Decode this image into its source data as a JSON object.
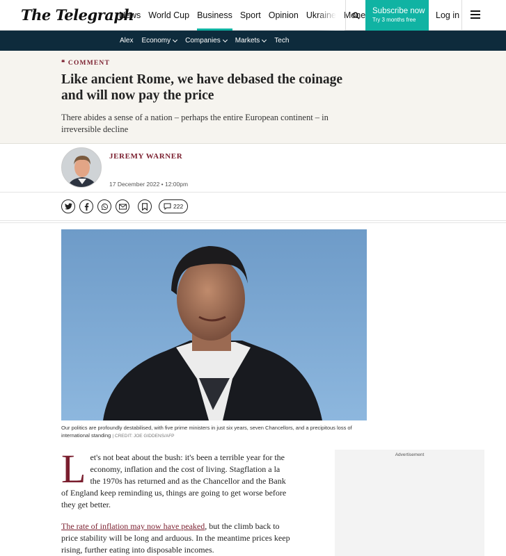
{
  "header": {
    "logo": "The Telegraph",
    "nav": [
      "News",
      "World Cup",
      "Business",
      "Sport",
      "Opinion",
      "Ukraine",
      "Money"
    ],
    "active_nav": "Business",
    "subscribe_label": "Subscribe now",
    "subscribe_sub": "Try 3 months free",
    "login": "Log in",
    "accent": "#10b3a3"
  },
  "subnav": {
    "items": [
      {
        "label": "Alex",
        "dropdown": false
      },
      {
        "label": "Economy",
        "dropdown": true
      },
      {
        "label": "Companies",
        "dropdown": true
      },
      {
        "label": "Markets",
        "dropdown": true
      },
      {
        "label": "Tech",
        "dropdown": false
      }
    ],
    "bg": "#0e2b3c"
  },
  "article": {
    "section": "COMMENT",
    "section_icon": "quote-icon",
    "headline": "Like ancient Rome, we have debased the coinage and will now pay the price",
    "standfirst": "There abides a sense of a nation – perhaps the entire European continent – in irreversible decline",
    "author": "JEREMY WARNER",
    "date": "17 December 2022 • 12:00pm",
    "comments_count": "222",
    "caption": "Our politics are profoundly destabilised, with five prime ministers in just six years, seven Chancellors, and a precipitous loss of international standing",
    "credit": "| CREDIT: JOE GIDDENS/AFP",
    "dropcap": "L",
    "para1": "et's not beat about the bush: it's been a terrible year for the economy, inflation and the cost of living. Stagflation a la the 1970s has returned and as the Chancellor and the Bank of England keep reminding us, things are going to get worse before they get better.",
    "para2_link": "The rate of inflation may now have peaked",
    "para2_rest": ", but the climb back to price stability will be long and arduous. In the meantime prices keep rising, further eating into disposable incomes.",
    "brand_color": "#7a1e2e"
  },
  "ad": {
    "label": "Advertisement"
  }
}
